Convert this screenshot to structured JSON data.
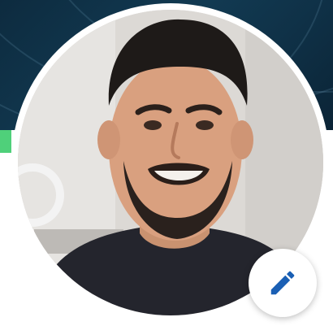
{
  "profile": {
    "avatar_icon": "profile-photo",
    "edit_icon": "pencil-icon",
    "accent_color": "#1a5fb4",
    "banner_color": "#0d2b3f",
    "highlight_color": "#4fd07a"
  }
}
